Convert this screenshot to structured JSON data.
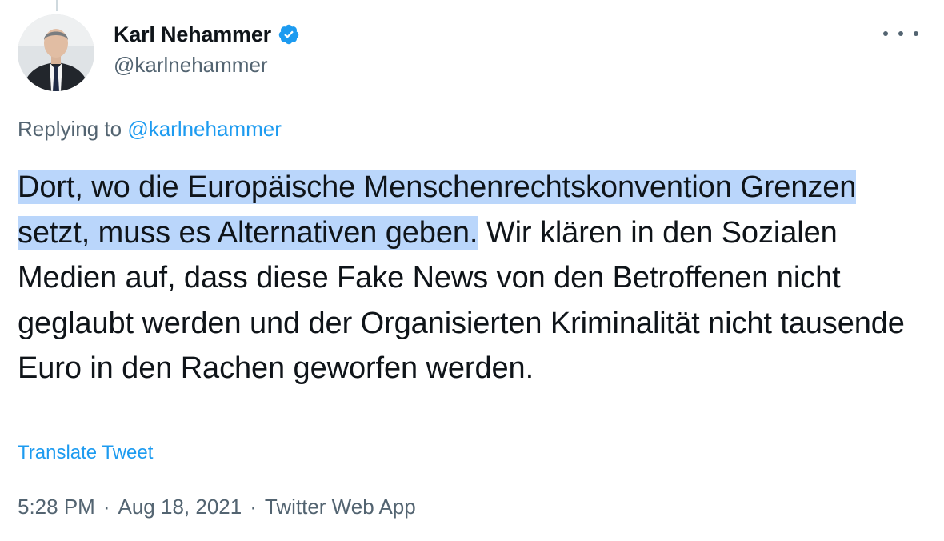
{
  "author": {
    "display_name": "Karl Nehammer",
    "handle": "@karlnehammer",
    "verified": true
  },
  "reply": {
    "prefix": "Replying to",
    "handle": "@karlnehammer"
  },
  "tweet": {
    "highlighted_text": "Dort, wo die Europäische Menschenrechtskonvention Grenzen setzt, muss es Alternativen geben.",
    "text": " Wir klären in den Sozialen Medien auf, dass diese Fake News von den Betroffenen nicht geglaubt werden und der Organisierten Kriminalität nicht tausende Euro in den Rachen geworfen werden."
  },
  "translate_label": "Translate Tweet",
  "meta": {
    "time": "5:28 PM",
    "date": "Aug 18, 2021",
    "source": "Twitter Web App",
    "separator": "·"
  },
  "icons": {
    "verified": "verified-badge-icon",
    "more": "more-options-icon"
  },
  "colors": {
    "accent": "#1d9bf0",
    "selection_highlight": "#bad6fb",
    "secondary_text": "#536471"
  }
}
